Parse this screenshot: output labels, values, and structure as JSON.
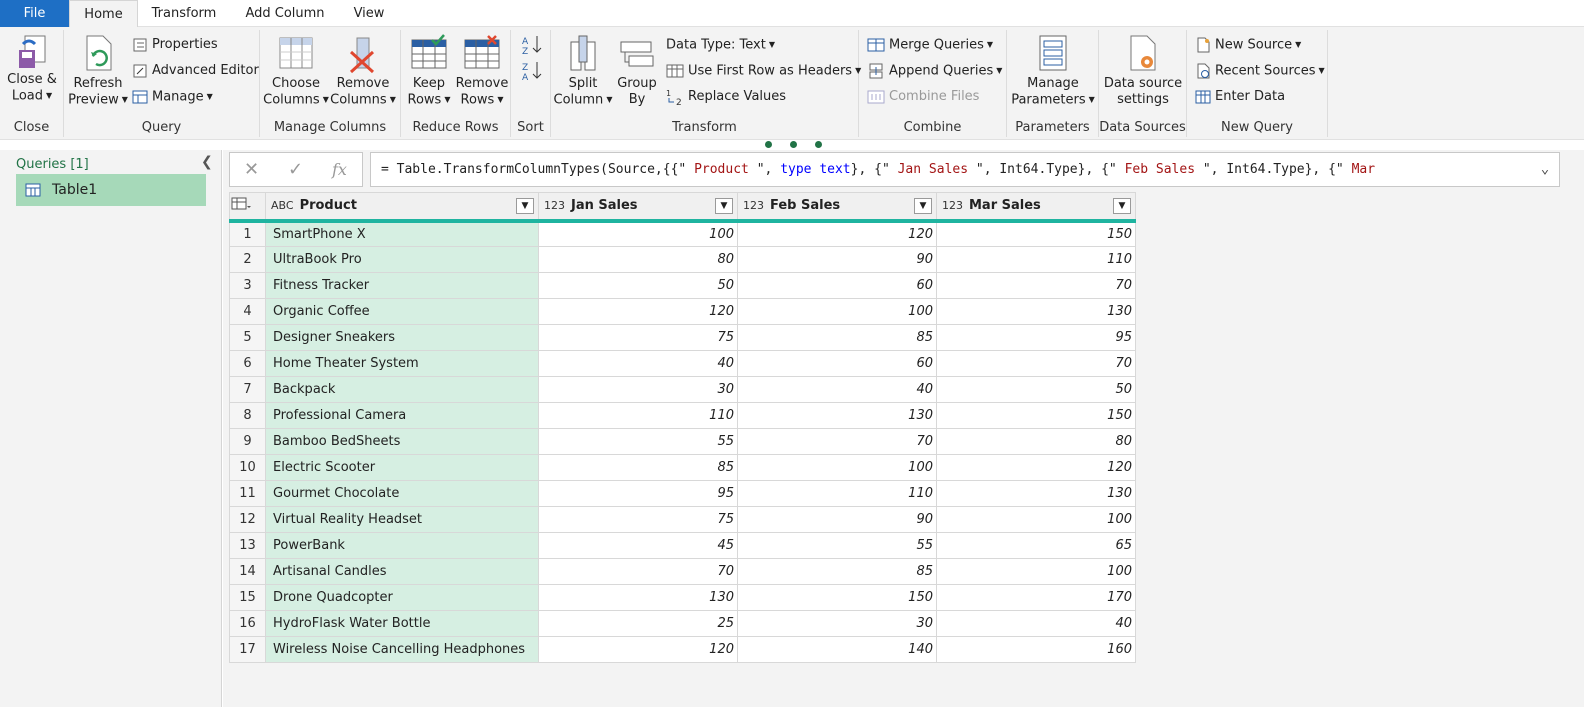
{
  "tabs": {
    "file": "File",
    "home": "Home",
    "transform": "Transform",
    "add_column": "Add Column",
    "view": "View"
  },
  "ribbon": {
    "close": {
      "close_load": "Close &",
      "close_load2": "Load",
      "label": "Close"
    },
    "query": {
      "refresh": "Refresh",
      "refresh2": "Preview",
      "properties": "Properties",
      "advanced_editor": "Advanced Editor",
      "manage": "Manage",
      "label": "Query"
    },
    "manage_columns": {
      "choose": "Choose",
      "choose2": "Columns",
      "remove": "Remove",
      "remove2": "Columns",
      "label": "Manage Columns"
    },
    "reduce_rows": {
      "keep": "Keep",
      "keep2": "Rows",
      "remove": "Remove",
      "remove2": "Rows",
      "label": "Reduce Rows"
    },
    "sort": {
      "label": "Sort"
    },
    "transform": {
      "split": "Split",
      "split2": "Column",
      "group": "Group",
      "group2": "By",
      "data_type": "Data Type: Text",
      "first_row": "Use First Row as Headers",
      "replace": "Replace Values",
      "label": "Transform"
    },
    "combine": {
      "merge": "Merge Queries",
      "append": "Append Queries",
      "combine_files": "Combine Files",
      "label": "Combine"
    },
    "parameters": {
      "manage": "Manage",
      "manage2": "Parameters",
      "label": "Parameters"
    },
    "data_sources": {
      "settings": "Data source",
      "settings2": "settings",
      "label": "Data Sources"
    },
    "new_query": {
      "new_source": "New Source",
      "recent_sources": "Recent Sources",
      "enter_data": "Enter Data",
      "label": "New Query"
    }
  },
  "queries": {
    "header": "Queries [1]",
    "items": [
      "Table1"
    ]
  },
  "formula": {
    "prefix": "= Table.TransformColumnTypes(Source,{{\"",
    "s1": " Product           ",
    "m1": "\", ",
    "k1": "type text",
    "m2": "}, {\"",
    "s2": " Jan Sales ",
    "m3": "\", Int64.Type}, {\"",
    "s3": " Feb Sales ",
    "m4": "\", Int64.Type}, {\"",
    "s4": " Mar"
  },
  "table": {
    "type_text": "ABC",
    "type_num": "123",
    "columns": [
      "Product",
      "Jan Sales",
      "Feb Sales",
      "Mar Sales"
    ],
    "rows": [
      [
        "1",
        "SmartPhone X",
        "100",
        "120",
        "150"
      ],
      [
        "2",
        "UltraBook Pro",
        "80",
        "90",
        "110"
      ],
      [
        "3",
        "Fitness Tracker",
        "50",
        "60",
        "70"
      ],
      [
        "4",
        "Organic Coffee",
        "120",
        "100",
        "130"
      ],
      [
        "5",
        "Designer Sneakers",
        "75",
        "85",
        "95"
      ],
      [
        "6",
        "Home Theater System",
        "40",
        "60",
        "70"
      ],
      [
        "7",
        "Backpack",
        "30",
        "40",
        "50"
      ],
      [
        "8",
        "Professional Camera",
        "110",
        "130",
        "150"
      ],
      [
        "9",
        "Bamboo BedSheets",
        "55",
        "70",
        "80"
      ],
      [
        "10",
        "Electric Scooter",
        "85",
        "100",
        "120"
      ],
      [
        "11",
        "Gourmet Chocolate",
        "95",
        "110",
        "130"
      ],
      [
        "12",
        "Virtual Reality Headset",
        "75",
        "90",
        "100"
      ],
      [
        "13",
        "PowerBank",
        "45",
        "55",
        "65"
      ],
      [
        "14",
        "Artisanal Candles",
        "70",
        "85",
        "100"
      ],
      [
        "15",
        "Drone Quadcopter",
        "130",
        "150",
        "170"
      ],
      [
        "16",
        "HydroFlask Water Bottle",
        "25",
        "30",
        "40"
      ],
      [
        "17",
        "Wireless Noise Cancelling Headphones",
        "120",
        "140",
        "160"
      ]
    ]
  },
  "colors": {
    "file_tab": "#1e6fc5",
    "accent": "#217346",
    "query_selected": "#a6d9b9",
    "product_col": "#d6efe2",
    "header_underline": "#1fb4a0"
  }
}
